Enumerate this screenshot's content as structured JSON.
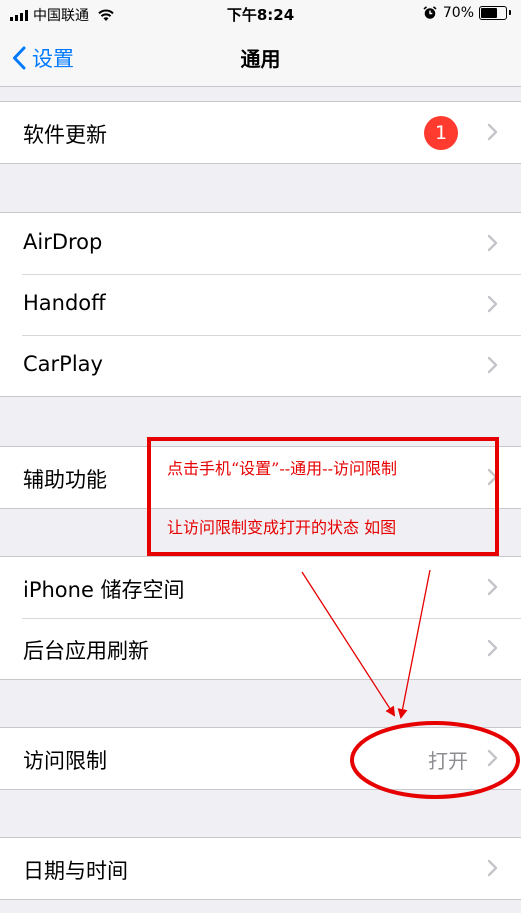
{
  "status_bar": {
    "carrier": "中国联通",
    "time": "下午8:24",
    "battery_percent": "70%",
    "battery_level": 0.7
  },
  "nav": {
    "back_label": "设置",
    "title": "通用"
  },
  "groups": {
    "software_update": {
      "label": "软件更新",
      "badge": "1"
    },
    "airdrop": {
      "label": "AirDrop"
    },
    "handoff": {
      "label": "Handoff"
    },
    "carplay": {
      "label": "CarPlay"
    },
    "accessibility": {
      "label": "辅助功能"
    },
    "iphone_storage": {
      "label": "iPhone 储存空间"
    },
    "background_refresh": {
      "label": "后台应用刷新"
    },
    "restrictions": {
      "label": "访问限制",
      "value": "打开"
    },
    "date_time": {
      "label": "日期与时间"
    }
  },
  "annotation": {
    "line1": "点击手机“设置”--通用--访问限制",
    "line2": "让访问限制变成打开的状态   如图",
    "color": "#e60000"
  },
  "colors": {
    "accent": "#007aff",
    "badge": "#ff3b30",
    "background": "#efeff4"
  }
}
